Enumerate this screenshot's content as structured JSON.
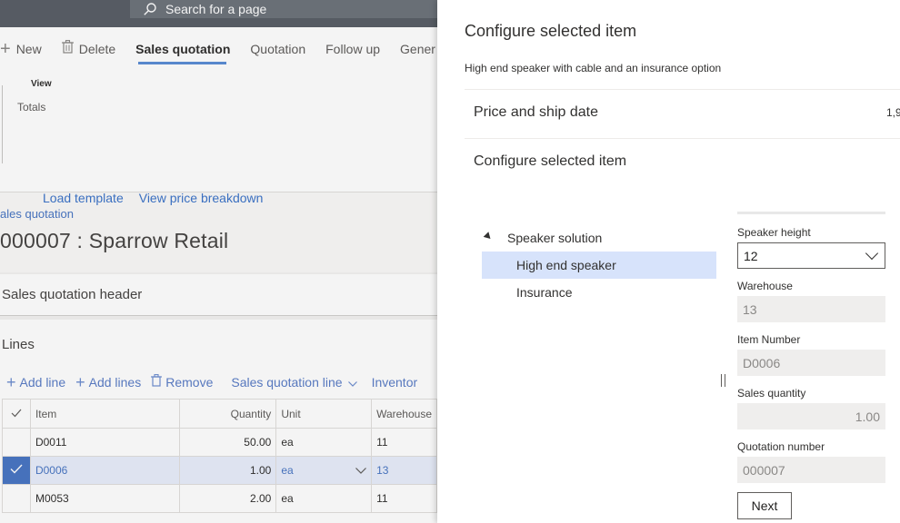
{
  "search": {
    "placeholder": "Search for a page"
  },
  "actions": {
    "new": "New",
    "delete": "Delete",
    "tab_sales_quotation": "Sales quotation",
    "tab_quotation": "Quotation",
    "tab_follow_up": "Follow up",
    "tab_general": "Gener"
  },
  "ribbon": {
    "group_title": "View",
    "item_totals": "Totals"
  },
  "header": {
    "breadcrumb": "ales quotation",
    "title": "000007 : Sparrow Retail"
  },
  "fasttabs": {
    "header_title": "Sales quotation header",
    "lines_title": "Lines"
  },
  "lines_toolbar": {
    "add_line": "Add line",
    "add_lines": "Add lines",
    "remove": "Remove",
    "sales_quotation_line": "Sales quotation line",
    "inventory": "Inventor"
  },
  "grid": {
    "columns": [
      "Item",
      "Quantity",
      "Unit",
      "Warehouse"
    ],
    "rows": [
      {
        "item": "D0011",
        "quantity": "50.00",
        "unit": "ea",
        "warehouse": "11",
        "selected": false
      },
      {
        "item": "D0006",
        "quantity": "1.00",
        "unit": "ea",
        "warehouse": "13",
        "selected": true
      },
      {
        "item": "M0053",
        "quantity": "2.00",
        "unit": "ea",
        "warehouse": "11",
        "selected": false
      }
    ]
  },
  "panel": {
    "title": "Configure selected item",
    "description": "High end speaker with cable and an insurance option",
    "price_section_title": "Price and ship date",
    "price_value": "1,9",
    "config_section_title": "Configure selected item",
    "load_template": "Load template",
    "view_price_breakdown": "View price breakdown",
    "tree": {
      "root": "Speaker solution",
      "children": [
        "High end speaker",
        "Insurance"
      ],
      "selected": "High end speaker"
    },
    "fields": {
      "speaker_height": {
        "label": "Speaker height",
        "value": "12"
      },
      "warehouse": {
        "label": "Warehouse",
        "value": "13"
      },
      "item_number": {
        "label": "Item Number",
        "value": "D0006"
      },
      "sales_quantity": {
        "label": "Sales quantity",
        "value": "1.00"
      },
      "quotation_number": {
        "label": "Quotation number",
        "value": "000007"
      }
    },
    "next_label": "Next"
  },
  "colors": {
    "accent": "#4a77c4",
    "link": "#3a6fc0",
    "selected_row": "#e8eefb",
    "selected_node": "#d7e3fb",
    "topbar": "#5a6068"
  }
}
